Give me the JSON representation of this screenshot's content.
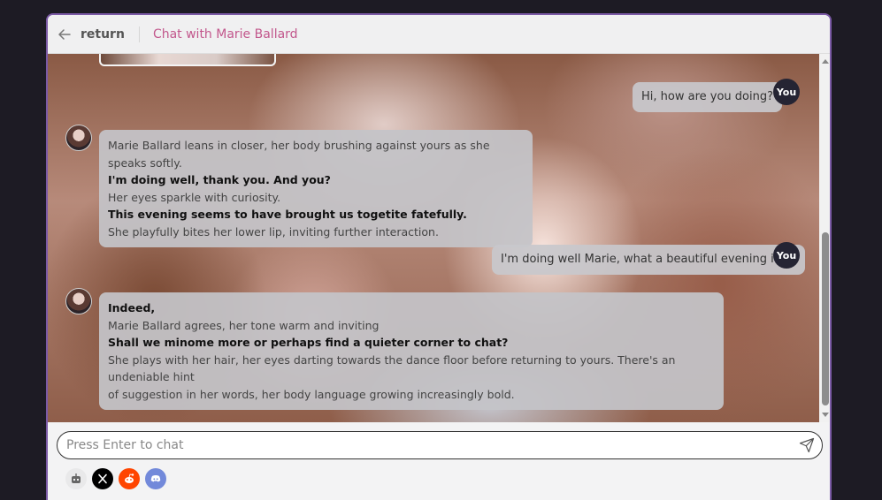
{
  "header": {
    "back_label": "return",
    "chat_title": "Chat with Marie Ballard"
  },
  "messages": [
    {
      "role": "user",
      "badge": "You",
      "text": "Hi, how are you doing?"
    },
    {
      "role": "bot",
      "lines": [
        {
          "text": "Marie Ballard leans in closer, her body brushing against yours as she speaks softly.",
          "bold": false
        },
        {
          "text": "I'm doing well, thank you. And you?",
          "bold": true
        },
        {
          "text": "Her eyes sparkle with curiosity.",
          "bold": false
        },
        {
          "text": "This evening seems to have brought us togetite fatefully.",
          "bold": true
        },
        {
          "text": "She playfully bites her lower lip, inviting further interaction.",
          "bold": false
        }
      ]
    },
    {
      "role": "user",
      "badge": "You",
      "text": "I'm doing well Marie, what a beautiful evening it is!"
    },
    {
      "role": "bot",
      "lines": [
        {
          "text": "Indeed,",
          "bold": true
        },
        {
          "text": "Marie Ballard agrees, her tone warm and inviting",
          "bold": false
        },
        {
          "text": "Shall we minome more or perhaps find a quieter corner to chat?",
          "bold": true
        },
        {
          "text": "She plays with her hair, her eyes darting towards the dance floor before returning to yours. There's an undeniable hint",
          "bold": false
        },
        {
          "text": "of suggestion in her words, her body language growing increasingly bold.",
          "bold": false
        }
      ]
    }
  ],
  "input": {
    "placeholder": "Press Enter to chat",
    "value": ""
  },
  "footer_icons": [
    "robot-icon",
    "x-icon",
    "reddit-icon",
    "discord-icon"
  ],
  "colors": {
    "accent_border": "#7b5aa6",
    "title_pink": "#c2578c",
    "you_badge": "#252433",
    "x_black": "#000000",
    "reddit_orange": "#ff4500",
    "discord_blue": "#7289da"
  }
}
